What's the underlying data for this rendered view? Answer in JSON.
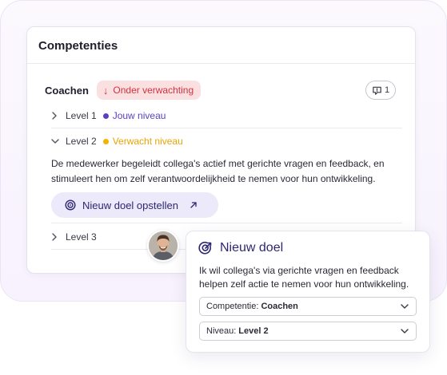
{
  "card": {
    "title": "Competenties"
  },
  "competence": {
    "name": "Coachen",
    "status_label": "Onder verwachting",
    "comment_count": "1"
  },
  "levels": [
    {
      "label": "Level 1",
      "tag": "Jouw niveau",
      "tag_color": "#5a3fc4"
    },
    {
      "label": "Level 2",
      "tag": "Verwacht niveau",
      "tag_color": "#e9a400"
    },
    {
      "label": "Level 3"
    }
  ],
  "level2_description": "De medewerker begeleidt collega's actief met gerichte vragen en feedback, en stimuleert hen om zelf verantwoordelijkheid te nemen voor hun ontwikkeling.",
  "new_goal_button": "Nieuw doel opstellen",
  "popup": {
    "title": "Nieuw doel",
    "description": "Ik wil collega's via gerichte vragen en feedback helpen zelf actie te nemen voor hun ontwikkeling.",
    "competence_select": {
      "label": "Competentie:",
      "value": "Coachen"
    },
    "level_select": {
      "label": "Niveau:",
      "value": "Level 2"
    }
  },
  "colors": {
    "accent": "#2e2670",
    "warning": "#d2323c",
    "warning_bg": "#fbe0e2",
    "button_bg": "#ebe9fa"
  }
}
